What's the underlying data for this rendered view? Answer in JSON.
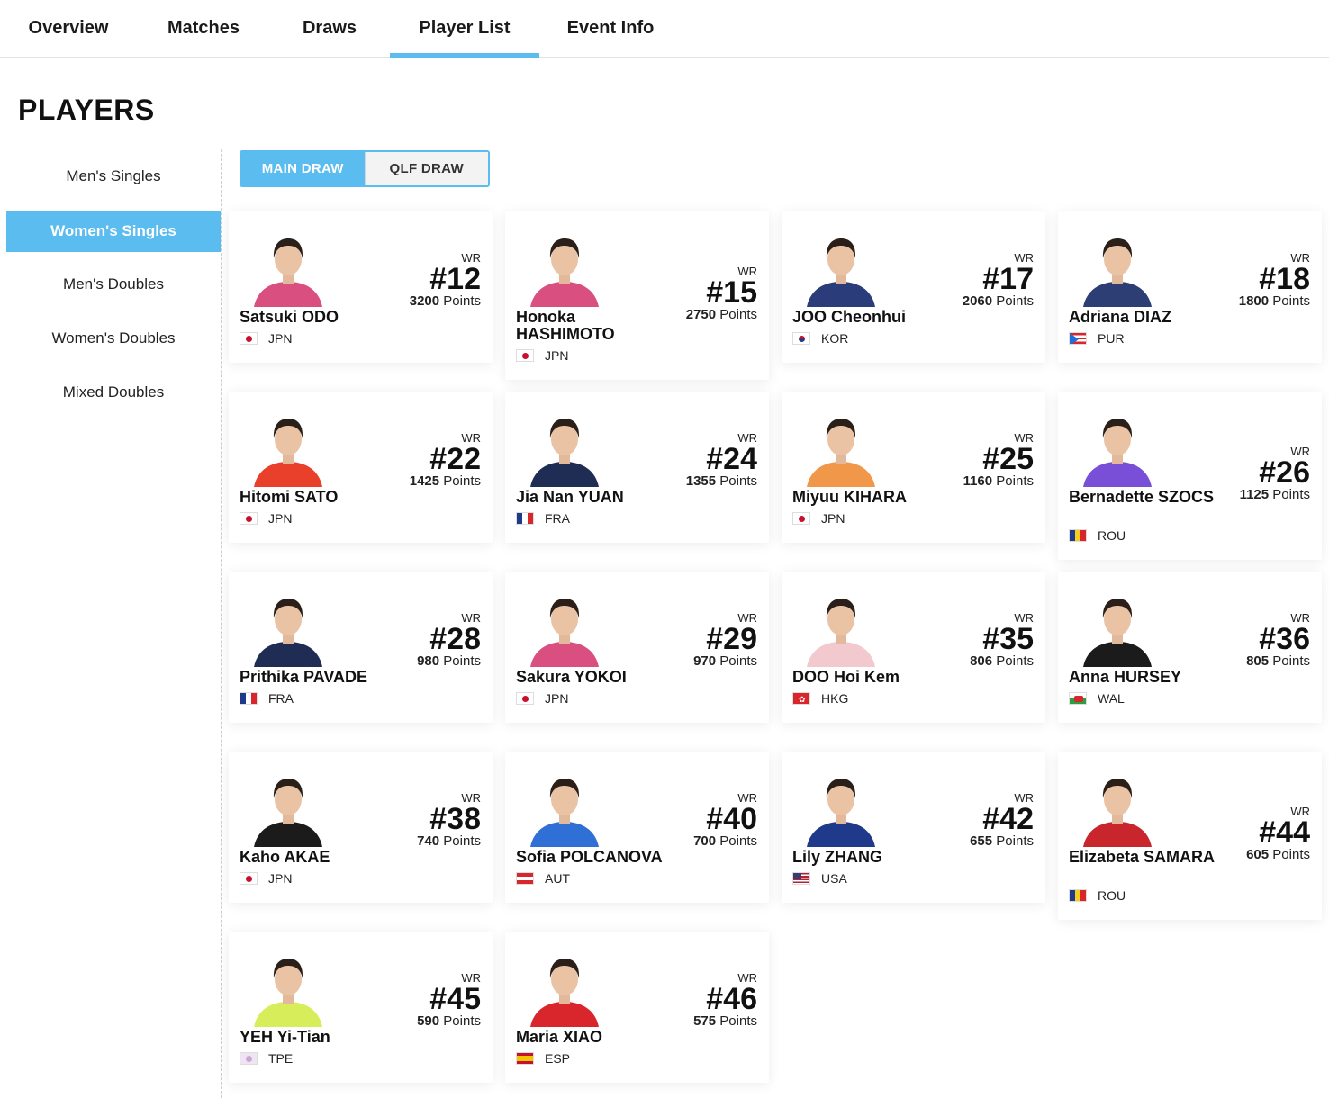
{
  "tabs": [
    {
      "label": "Overview",
      "active": false
    },
    {
      "label": "Matches",
      "active": false
    },
    {
      "label": "Draws",
      "active": false
    },
    {
      "label": "Player List",
      "active": true
    },
    {
      "label": "Event Info",
      "active": false
    }
  ],
  "page_title": "PLAYERS",
  "sidebar": {
    "items": [
      {
        "label": "Men's Singles",
        "active": false
      },
      {
        "label": "Women's Singles",
        "active": true
      },
      {
        "label": "Men's Doubles",
        "active": false
      },
      {
        "label": "Women's Doubles",
        "active": false
      },
      {
        "label": "Mixed Doubles",
        "active": false
      }
    ]
  },
  "draw_toggle": {
    "main": "MAIN DRAW",
    "qlf": "QLF DRAW",
    "selected": "MAIN DRAW"
  },
  "accent_color": "#5bbcf0",
  "rank_label": "WR",
  "points_suffix": "Points",
  "players": [
    {
      "name": "Satsuki ODO",
      "country": "JPN",
      "rank": "#12",
      "points": "3200",
      "shirt": "#d94f7f"
    },
    {
      "name": "Honoka HASHIMOTO",
      "country": "JPN",
      "rank": "#15",
      "points": "2750",
      "shirt": "#d94f7f"
    },
    {
      "name": "JOO Cheonhui",
      "country": "KOR",
      "rank": "#17",
      "points": "2060",
      "shirt": "#2a3d7a"
    },
    {
      "name": "Adriana DIAZ",
      "country": "PUR",
      "rank": "#18",
      "points": "1800",
      "shirt": "#2c3e73"
    },
    {
      "name": "Hitomi SATO",
      "country": "JPN",
      "rank": "#22",
      "points": "1425",
      "shirt": "#e8402a"
    },
    {
      "name": "Jia Nan YUAN",
      "country": "FRA",
      "rank": "#24",
      "points": "1355",
      "shirt": "#1f2d55"
    },
    {
      "name": "Miyuu KIHARA",
      "country": "JPN",
      "rank": "#25",
      "points": "1160",
      "shirt": "#f0974a"
    },
    {
      "name": "Bernadette SZOCS",
      "country": "ROU",
      "rank": "#26",
      "points": "1125",
      "shirt": "#7a4fd8"
    },
    {
      "name": "Prithika PAVADE",
      "country": "FRA",
      "rank": "#28",
      "points": "980",
      "shirt": "#1f2d55"
    },
    {
      "name": "Sakura YOKOI",
      "country": "JPN",
      "rank": "#29",
      "points": "970",
      "shirt": "#d94f7f"
    },
    {
      "name": "DOO Hoi Kem",
      "country": "HKG",
      "rank": "#35",
      "points": "806",
      "shirt": "#f1c9cf"
    },
    {
      "name": "Anna HURSEY",
      "country": "WAL",
      "rank": "#36",
      "points": "805",
      "shirt": "#1b1b1b"
    },
    {
      "name": "Kaho AKAE",
      "country": "JPN",
      "rank": "#38",
      "points": "740",
      "shirt": "#1b1b1b"
    },
    {
      "name": "Sofia POLCANOVA",
      "country": "AUT",
      "rank": "#40",
      "points": "700",
      "shirt": "#2f6fd6"
    },
    {
      "name": "Lily ZHANG",
      "country": "USA",
      "rank": "#42",
      "points": "655",
      "shirt": "#1f3a8a"
    },
    {
      "name": "Elizabeta SAMARA",
      "country": "ROU",
      "rank": "#44",
      "points": "605",
      "shirt": "#c8262c"
    },
    {
      "name": "YEH Yi-Tian",
      "country": "TPE",
      "rank": "#45",
      "points": "590",
      "shirt": "#d7ee5a"
    },
    {
      "name": "Maria XIAO",
      "country": "ESP",
      "rank": "#46",
      "points": "575",
      "shirt": "#d8262c"
    }
  ]
}
